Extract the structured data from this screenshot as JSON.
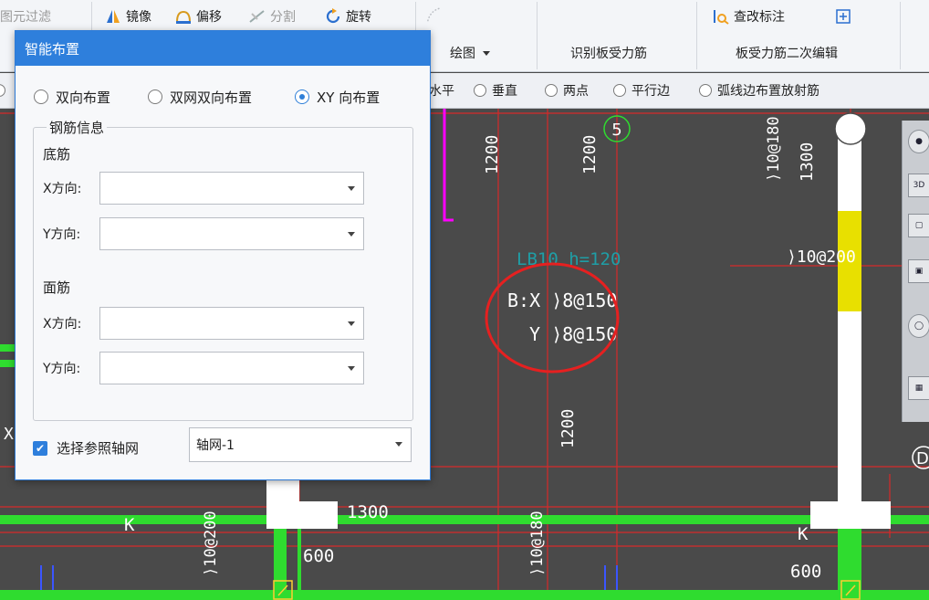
{
  "toolbar": {
    "element_filter": "图元过滤",
    "mirror": "镜像",
    "offset": "偏移",
    "split": "分割",
    "rotate": "旋转",
    "check_mark": "查改标注",
    "draw_group": "绘图",
    "group_identify": "识别板受力筋",
    "group_second_edit": "板受力筋二次编辑"
  },
  "options_bar": {
    "items": [
      "水平",
      "垂直",
      "两点",
      "平行边",
      "弧线边布置放射筋"
    ]
  },
  "dialog": {
    "title": "智能布置",
    "modes": [
      {
        "label": "双向布置",
        "selected": false
      },
      {
        "label": "双网双向布置",
        "selected": false
      },
      {
        "label": "XY 向布置",
        "selected": true
      }
    ],
    "group_title": "钢筋信息",
    "bottom_title": "底筋",
    "top_title": "面筋",
    "x_label": "X方向:",
    "y_label": "Y方向:",
    "bottom_x_value": "",
    "bottom_y_value": "",
    "top_x_value": "",
    "top_y_value": "",
    "ref_grid_label": "选择参照轴网",
    "ref_grid_checked": true,
    "ref_grid_value": "轴网-1"
  },
  "canvas": {
    "axis_label": "5",
    "slab_label": "LB10 h=120",
    "rebar_x": "B:X ⟩8@150",
    "rebar_y": "Y ⟩8@150",
    "dim_1200": "1200",
    "dim_1300": "1300",
    "dim_600": "600",
    "beam_rebar_left": "⟩10@200",
    "beam_rebar_mid": "⟩10@180",
    "beam_rebar_right": "⟩10@180",
    "wall_rebar_right": "⟩10@200",
    "grid_k": "K",
    "grid_x": "X",
    "grid_d": "D",
    "toolbox_3d": "3D",
    "colors": {
      "beam": "#2fdc2f",
      "grid": "#d62a2a",
      "wall": "#ffffff",
      "highlight": "#e8e000",
      "slab_label": "#1f9ea6",
      "circle": "#e62020"
    }
  }
}
